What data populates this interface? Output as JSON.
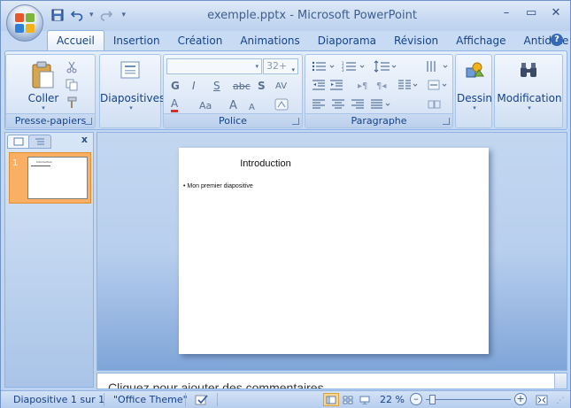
{
  "window": {
    "title": "exemple.pptx - Microsoft PowerPoint",
    "controls": {
      "minimize": "–",
      "restore": "▭",
      "close": "✕"
    }
  },
  "quick_access": {
    "more": "▾"
  },
  "tabs": [
    {
      "label": "Accueil",
      "active": true
    },
    {
      "label": "Insertion"
    },
    {
      "label": "Création"
    },
    {
      "label": "Animations"
    },
    {
      "label": "Diaporama"
    },
    {
      "label": "Révision"
    },
    {
      "label": "Affichage"
    },
    {
      "label": "Antidote"
    }
  ],
  "ribbon": {
    "clipboard": {
      "paste_label": "Coller",
      "group_label": "Presse-papiers"
    },
    "slides": {
      "button_label": "Diapositives"
    },
    "font": {
      "group_label": "Police",
      "font_name": "",
      "font_size": "32+",
      "bold": "G",
      "italic": "I",
      "underline": "S",
      "strike": "abc",
      "shadow": "S",
      "spacing": "AV",
      "color": "A",
      "case": "Aa",
      "grow": "A",
      "shrink": "A"
    },
    "paragraph": {
      "group_label": "Paragraphe"
    },
    "drawing": {
      "button_label": "Dessin"
    },
    "editing": {
      "button_label": "Modification"
    }
  },
  "slides_panel": {
    "close": "x",
    "slide_number": "1",
    "thumb_title": "Introduction"
  },
  "slide": {
    "title": "Introduction",
    "bullet": "Mon premier diapositive"
  },
  "notes": {
    "placeholder": "Cliquez pour ajouter des commentaires"
  },
  "status": {
    "slide_counter": "Diapositive 1 sur 1",
    "theme": "\"Office Theme\"",
    "zoom": "22 %"
  },
  "colors": {
    "accent": "#15428b",
    "ribbon_bg": "#d3e2f6",
    "selected_thumb": "#f9b064"
  }
}
